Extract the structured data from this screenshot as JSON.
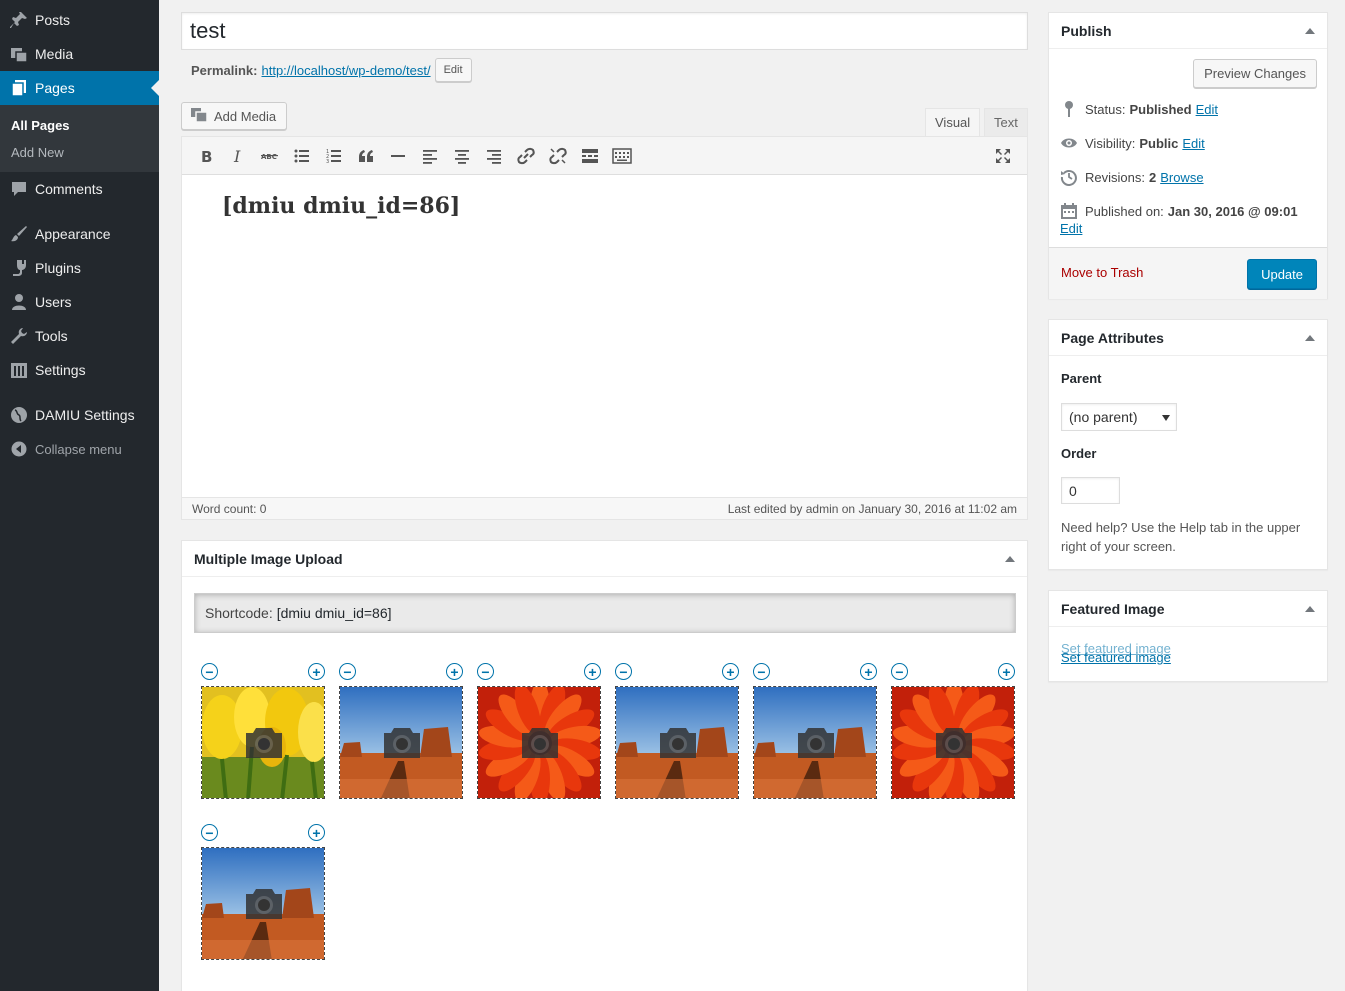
{
  "sidebar": {
    "items": [
      {
        "label": "Posts",
        "icon": "pushpin-icon"
      },
      {
        "label": "Media",
        "icon": "media-icon"
      },
      {
        "label": "Pages",
        "icon": "pages-icon"
      },
      {
        "label": "Comments",
        "icon": "comment-icon"
      },
      {
        "label": "Appearance",
        "icon": "paintbrush-icon"
      },
      {
        "label": "Plugins",
        "icon": "plug-icon"
      },
      {
        "label": "Users",
        "icon": "user-icon"
      },
      {
        "label": "Tools",
        "icon": "wrench-icon"
      },
      {
        "label": "Settings",
        "icon": "settings-icon"
      },
      {
        "label": "DAMIU Settings",
        "icon": "globe-icon"
      }
    ],
    "submenu": [
      "All Pages",
      "Add New"
    ],
    "collapse_label": "Collapse menu",
    "accent_color": "#0073aa"
  },
  "editor": {
    "title": "test",
    "permalink_label": "Permalink:",
    "permalink_url": "http://localhost/wp-demo/test/",
    "permalink_edit": "Edit",
    "add_media_label": "Add Media",
    "tab_visual": "Visual",
    "tab_text": "Text",
    "content": "[dmiu dmiu_id=86]",
    "word_count": "Word count: 0",
    "last_edited": "Last edited by admin on January 30, 2016 at 11:02 am",
    "toolbar_icons": [
      "bold-icon",
      "italic-icon",
      "strikethrough-icon",
      "bullet-list-icon",
      "numbered-list-icon",
      "blockquote-icon",
      "horizontal-rule-icon",
      "align-left-icon",
      "align-center-icon",
      "align-right-icon",
      "link-icon",
      "unlink-icon",
      "read-more-icon",
      "toolbar-toggle-icon",
      "fullscreen-icon"
    ]
  },
  "miu": {
    "title": "Multiple Image Upload",
    "shortcode_label": "Shortcode:",
    "shortcode_value": "[dmiu dmiu_id=86]",
    "images": [
      "tulips",
      "desert",
      "flower",
      "desert",
      "desert",
      "flower",
      "desert"
    ],
    "remove_symbol": "−",
    "add_symbol": "+"
  },
  "publish": {
    "title": "Publish",
    "preview_label": "Preview Changes",
    "status_label": "Status:",
    "status_value": "Published",
    "visibility_label": "Visibility:",
    "visibility_value": "Public",
    "revisions_label": "Revisions:",
    "revisions_value": "2",
    "browse_label": "Browse",
    "published_on_label": "Published on:",
    "published_on_value": "Jan 30, 2016 @ 09:01",
    "edit_label": "Edit",
    "trash_label": "Move to Trash",
    "update_label": "Update",
    "update_color": "#0085ba"
  },
  "page_attributes": {
    "title": "Page Attributes",
    "parent_label": "Parent",
    "parent_value": "(no parent)",
    "order_label": "Order",
    "order_value": "0",
    "help_text": "Need help? Use the Help tab in the upper right of your screen."
  },
  "featured_image": {
    "title": "Featured Image",
    "link_label": "Set featured image"
  }
}
